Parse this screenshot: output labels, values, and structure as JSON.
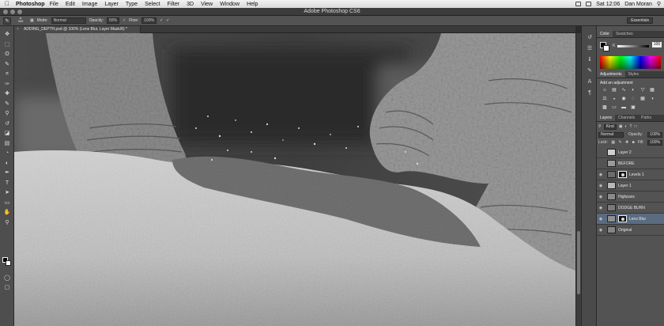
{
  "menubar": {
    "app_name": "Photoshop",
    "items": [
      "File",
      "Edit",
      "Image",
      "Layer",
      "Type",
      "Select",
      "Filter",
      "3D",
      "View",
      "Window",
      "Help"
    ],
    "clock": "Sat 12:06",
    "user": "Dan Moran"
  },
  "window": {
    "title": "Adobe Photoshop CS6"
  },
  "options": {
    "mode_label": "Mode:",
    "mode_value": "Normal",
    "opacity_label": "Opacity:",
    "opacity_value": "50%",
    "flow_label": "Flow:",
    "flow_value": "100%",
    "brush_size": "308",
    "workspace": "Essentials"
  },
  "document": {
    "tab_label": "ADDING_DEPTH.psd @ 100% (Lens Blur, Layer Mask/8) *",
    "close_glyph": "×"
  },
  "tools": [
    "move-tool",
    "marquee-tool",
    "lasso-tool",
    "quick-select-tool",
    "crop-tool",
    "eyedropper-tool",
    "healing-tool",
    "brush-tool",
    "clone-stamp-tool",
    "history-brush-tool",
    "eraser-tool",
    "gradient-tool",
    "blur-tool",
    "dodge-tool",
    "pen-tool",
    "type-tool",
    "path-select-tool",
    "shape-tool",
    "hand-tool",
    "zoom-tool"
  ],
  "panels": {
    "color_tabs": [
      "Color",
      "Swatches"
    ],
    "k_label": "K",
    "k_value": "100",
    "adj_tabs": [
      "Adjustments",
      "Styles"
    ],
    "adj_title": "Add an adjustment",
    "layers_tabs": [
      "Layers",
      "Channels",
      "Paths"
    ],
    "kind_label": "Kind",
    "blend_mode": "Normal",
    "opacity_label": "Opacity:",
    "opacity_value": "100%",
    "lock_label": "Lock:",
    "fill_label": "Fill:",
    "fill_value": "100%"
  },
  "layers": [
    {
      "name": "Layer 2",
      "visible": false,
      "has_mask": false,
      "selected": false,
      "tone": "#d0d0d0"
    },
    {
      "name": "BEFORE",
      "visible": false,
      "has_mask": false,
      "selected": false,
      "tone": "#9a9a9a"
    },
    {
      "name": "Levels 1",
      "visible": true,
      "has_mask": true,
      "selected": false,
      "tone": "#6c6c6c"
    },
    {
      "name": "Layer 1",
      "visible": true,
      "has_mask": false,
      "selected": false,
      "tone": "#b8b8b8"
    },
    {
      "name": "Highpass",
      "visible": true,
      "has_mask": false,
      "selected": false,
      "tone": "#8a8a8a"
    },
    {
      "name": "DODGE BURN",
      "visible": true,
      "has_mask": false,
      "selected": false,
      "tone": "#7a7a7a"
    },
    {
      "name": "Lens Blur",
      "visible": true,
      "has_mask": true,
      "selected": true,
      "tone": "#909090"
    },
    {
      "name": "Original",
      "visible": true,
      "has_mask": false,
      "selected": false,
      "tone": "#858585"
    }
  ],
  "colors": {
    "selected_layer": "#5b6b80"
  }
}
